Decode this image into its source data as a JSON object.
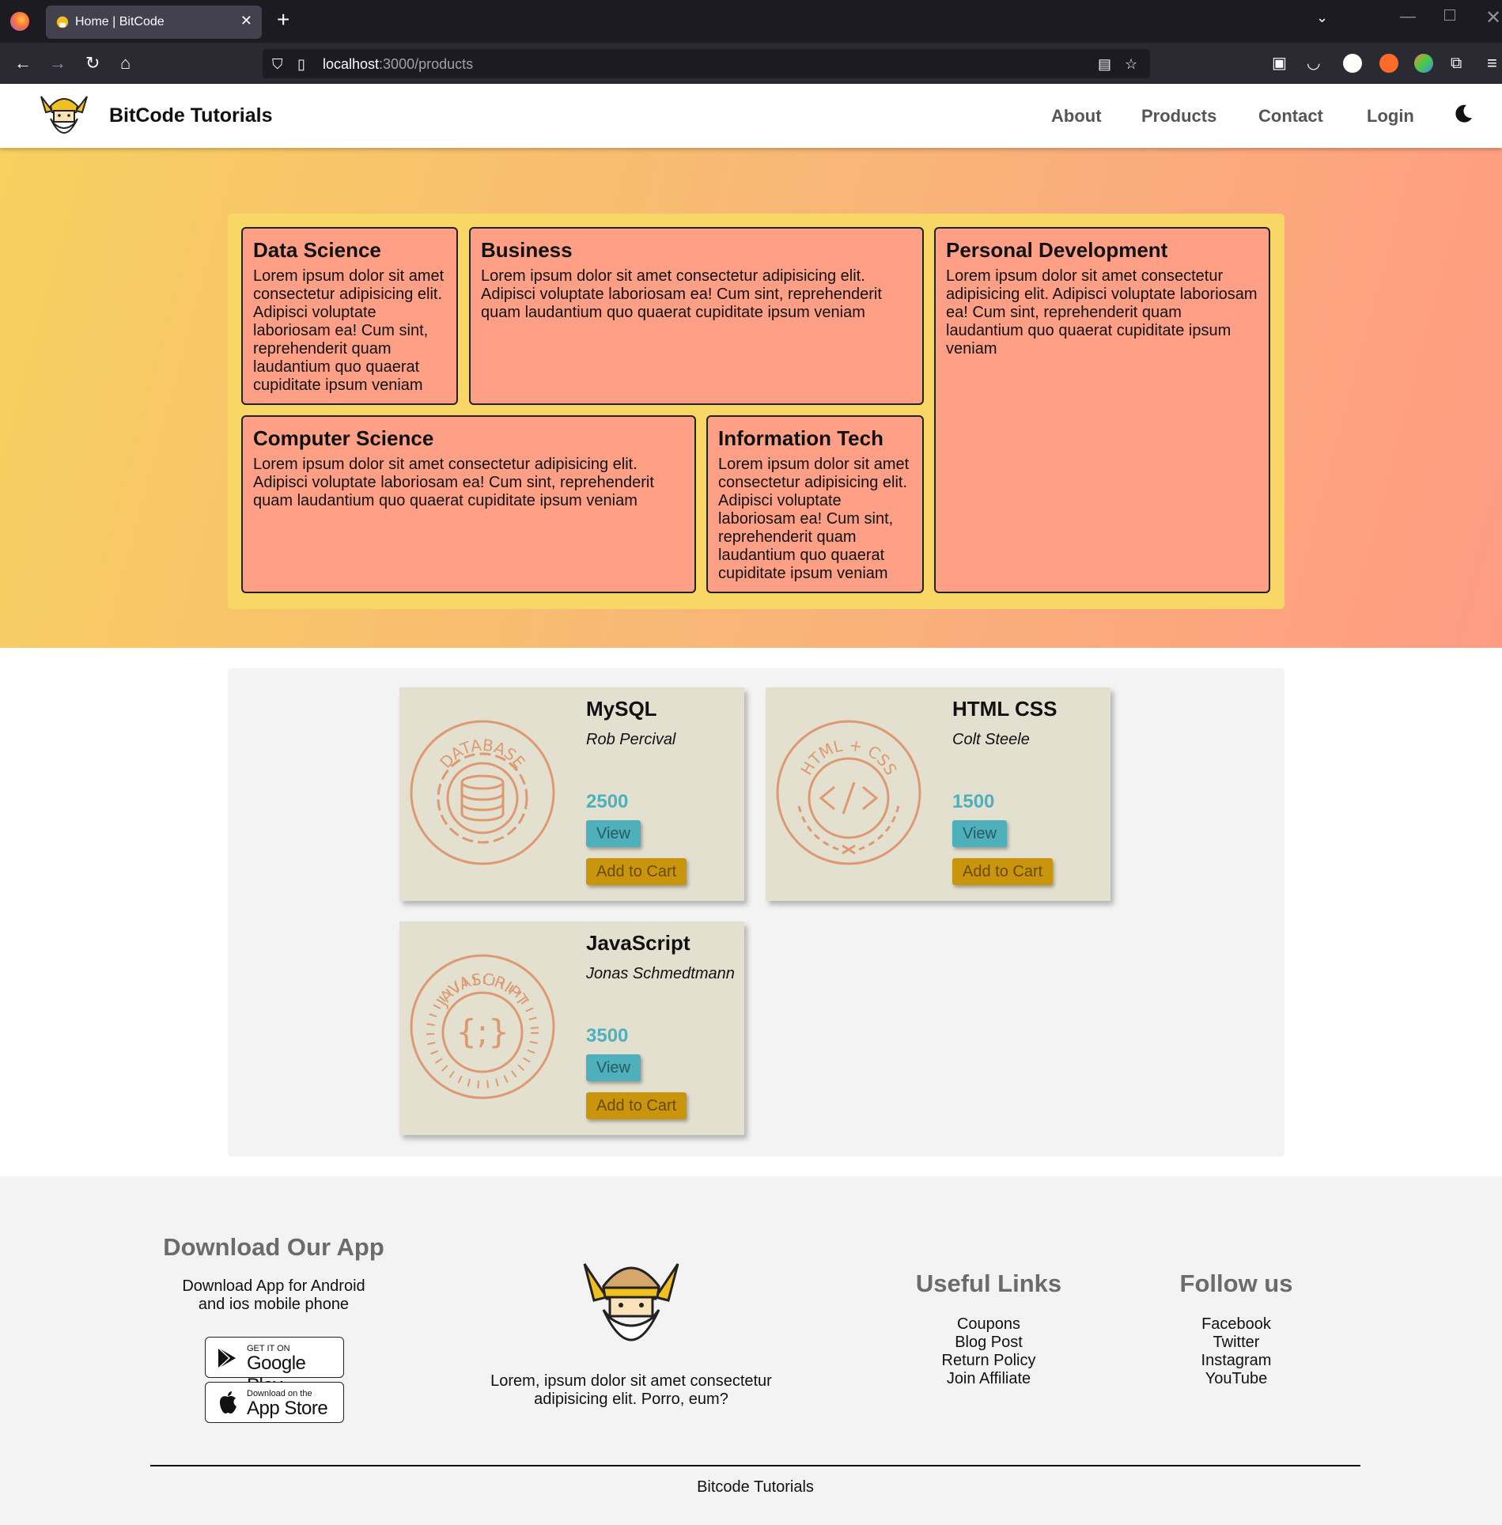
{
  "browser": {
    "tab_title": "Home | BitCode",
    "new_tab": "+",
    "url_host": "localhost",
    "url_path": ":3000/products"
  },
  "header": {
    "brand": "BitCode Tutorials",
    "nav": [
      "About",
      "Products",
      "Contact",
      "Login"
    ]
  },
  "categories": [
    {
      "title": "Data Science",
      "text": "Lorem ipsum dolor sit amet consectetur adipisicing elit. Adipisci voluptate laboriosam ea! Cum sint, reprehenderit quam laudantium quo quaerat cupiditate ipsum veniam"
    },
    {
      "title": "Business",
      "text": "Lorem ipsum dolor sit amet consectetur adipisicing elit. Adipisci voluptate laboriosam ea! Cum sint, reprehenderit quam laudantium quo quaerat cupiditate ipsum veniam"
    },
    {
      "title": "Personal Development",
      "text": "Lorem ipsum dolor sit amet consectetur adipisicing elit. Adipisci voluptate laboriosam ea! Cum sint, reprehenderit quam laudantium quo quaerat cupiditate ipsum veniam"
    },
    {
      "title": "Computer Science",
      "text": "Lorem ipsum dolor sit amet consectetur adipisicing elit. Adipisci voluptate laboriosam ea! Cum sint, reprehenderit quam laudantium quo quaerat cupiditate ipsum veniam"
    },
    {
      "title": "Information Tech",
      "text": "Lorem ipsum dolor sit amet consectetur adipisicing elit. Adipisci voluptate laboriosam ea! Cum sint, reprehenderit quam laudantium quo quaerat cupiditate ipsum veniam"
    }
  ],
  "products": [
    {
      "title": "MySQL",
      "author": "Rob Percival",
      "price": "2500",
      "badge_text": "DATABASE",
      "icon": "database-icon"
    },
    {
      "title": "HTML CSS",
      "author": "Colt Steele",
      "price": "1500",
      "badge_text": "HTML + CSS",
      "icon": "code-icon"
    },
    {
      "title": "JavaScript",
      "author": "Jonas Schmedtmann",
      "price": "3500",
      "badge_text": "JAVASCRIPT",
      "icon": "braces-icon"
    }
  ],
  "product_buttons": {
    "view": "View",
    "add_to_cart": "Add to Cart"
  },
  "footer": {
    "app_heading": "Download Our App",
    "app_text": "Download App for Android and ios mobile phone",
    "google_small": "GET IT ON",
    "google_big": "Google Play",
    "apple_small": "Download on the",
    "apple_big": "App Store",
    "about_text": "Lorem, ipsum dolor sit amet consectetur adipisicing elit. Porro, eum?",
    "links_heading": "Useful Links",
    "links": [
      "Coupons",
      "Blog Post",
      "Return Policy",
      "Join Affiliate"
    ],
    "follow_heading": "Follow us",
    "follow": [
      "Facebook",
      "Twitter",
      "Instagram",
      "YouTube"
    ],
    "copyright": "Bitcode Tutorials"
  },
  "colors": {
    "card_bg": "#ff9f85",
    "grid_bg": "#f8d767",
    "price": "#4eb0bb",
    "view_btn": "#4eb0bb",
    "cart_btn": "#c9950d",
    "badge_stroke": "#dd9a72"
  }
}
